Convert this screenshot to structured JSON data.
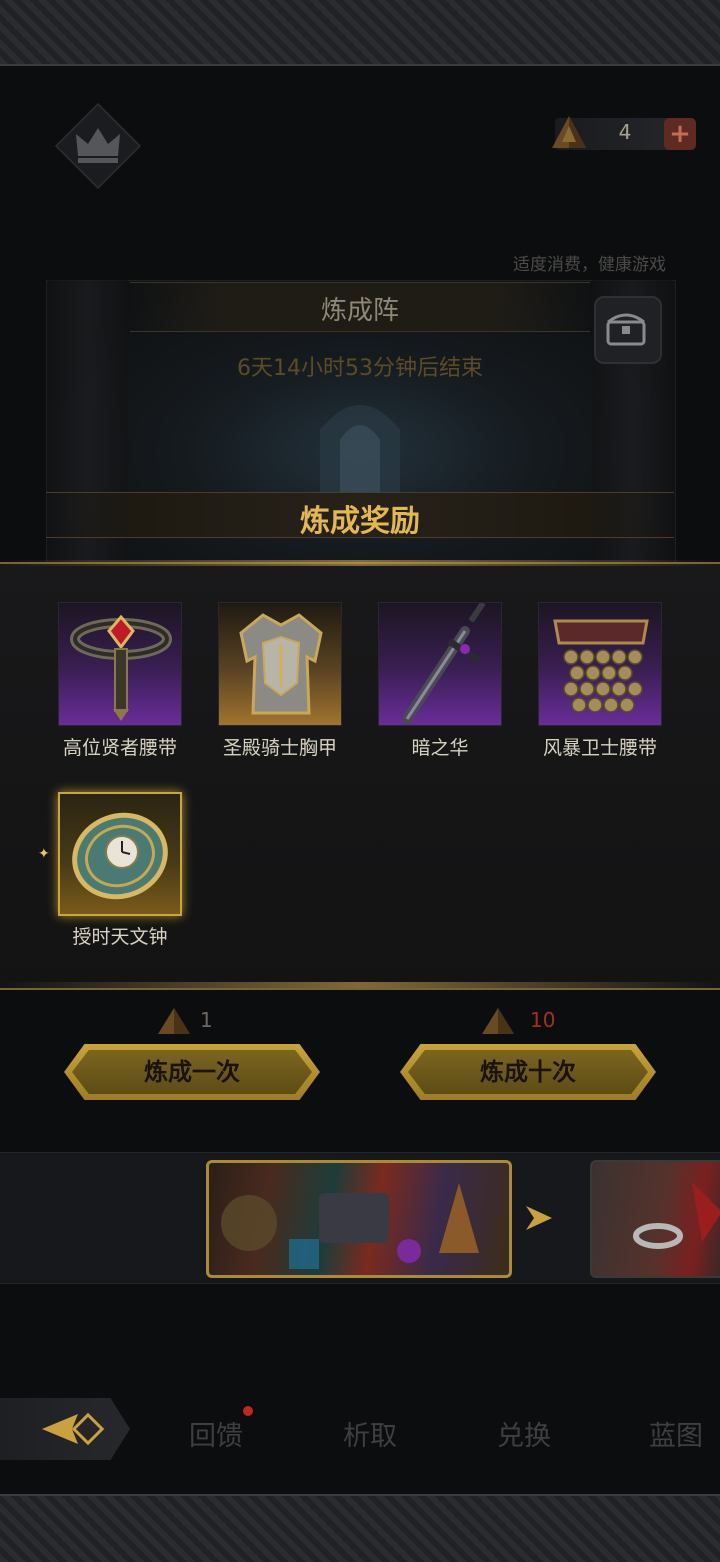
{
  "header": {
    "resource_count": "4",
    "plus_label": "+"
  },
  "notice": "适度消费，健康游戏",
  "event": {
    "title": "炼成阵",
    "timer": "6天14小时53分钟后结束"
  },
  "reward_popup": {
    "title": "炼成奖励",
    "items": [
      {
        "name": "高位贤者腰带",
        "rarity": "purple"
      },
      {
        "name": "圣殿骑士胸甲",
        "rarity": "gold"
      },
      {
        "name": "暗之华",
        "rarity": "purple"
      },
      {
        "name": "风暴卫士腰带",
        "rarity": "purple"
      },
      {
        "name": "授时天文钟",
        "rarity": "legendary"
      }
    ]
  },
  "actions": {
    "single": {
      "cost": "1",
      "label": "炼成一次"
    },
    "ten": {
      "cost": "10",
      "label": "炼成十次"
    }
  },
  "nav": {
    "feedback": "回馈",
    "extract": "析取",
    "exchange": "兑换",
    "blueprint": "蓝图"
  },
  "colors": {
    "gold_accent": "#e3b84e",
    "purple_rarity": "#6a2c9a",
    "cost_red": "#a3301f"
  }
}
